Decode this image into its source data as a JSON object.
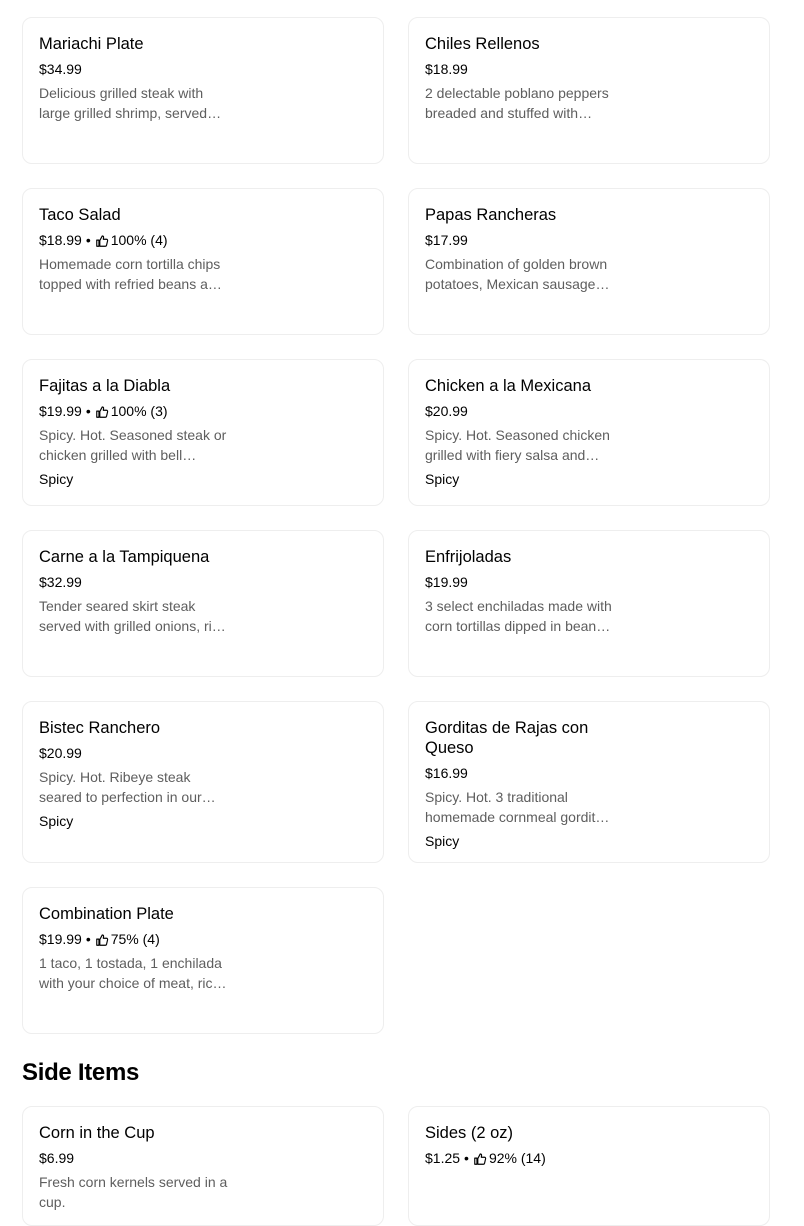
{
  "items": [
    {
      "name": "Mariachi Plate",
      "price": "$34.99",
      "rating": "",
      "desc": "Delicious grilled steak with large grilled shrimp, served with rice and beans.",
      "tag": ""
    },
    {
      "name": "Chiles Rellenos",
      "price": "$18.99",
      "rating": "",
      "desc": "2 delectable poblano peppers breaded and stuffed with cheese.",
      "tag": ""
    },
    {
      "name": "Taco Salad",
      "price": "$18.99",
      "rating": "100% (4)",
      "desc": "Homemade corn tortilla chips topped with refried beans and cheese.",
      "tag": ""
    },
    {
      "name": "Papas Rancheras",
      "price": "$17.99",
      "rating": "",
      "desc": "Combination of golden brown potatoes, Mexican sausage and eggs.",
      "tag": ""
    },
    {
      "name": "Fajitas a la Diabla",
      "price": "$19.99",
      "rating": "100% (3)",
      "desc": "Spicy. Hot. Seasoned steak or chicken grilled with bell peppers and onions.",
      "tag": "Spicy"
    },
    {
      "name": "Chicken a la Mexicana",
      "price": "$20.99",
      "rating": "",
      "desc": "Spicy. Hot. Seasoned chicken grilled with fiery salsa and vegetables.",
      "tag": "Spicy"
    },
    {
      "name": "Carne a la Tampiquena",
      "price": "$32.99",
      "rating": "",
      "desc": "Tender seared skirt steak served with grilled onions, rice and beans.",
      "tag": ""
    },
    {
      "name": "Enfrijoladas",
      "price": "$19.99",
      "rating": "",
      "desc": "3 select enchiladas made with corn tortillas dipped in bean sauce.",
      "tag": ""
    },
    {
      "name": "Bistec Ranchero",
      "price": "$20.99",
      "rating": "",
      "desc": "Spicy. Hot. Ribeye steak seared to perfection in our ranchero sauce.",
      "tag": "Spicy"
    },
    {
      "name": "Gorditas de Rajas con Queso",
      "price": "$16.99",
      "rating": "",
      "desc": "Spicy. Hot. 3 traditional homemade cornmeal gorditas stuffed with rajas.",
      "tag": "Spicy"
    },
    {
      "name": "Combination Plate",
      "price": "$19.99",
      "rating": "75% (4)",
      "desc": "1 taco, 1 tostada, 1 enchilada with your choice of meat, rice and beans.",
      "tag": ""
    },
    {
      "name": "Corn in the Cup",
      "price": "$6.99",
      "rating": "",
      "desc": "Fresh corn kernels served in a cup.",
      "tag": ""
    },
    {
      "name": "Sides (2 oz)",
      "price": "$1.25",
      "rating": "92% (14)",
      "desc": "",
      "tag": ""
    }
  ],
  "section_side_items": "Side Items",
  "icon_thumbs_up": "thumbs-up-icon",
  "colors": {
    "text": "#000000",
    "muted": "#5e5e5e",
    "border": "#eeeeee"
  }
}
